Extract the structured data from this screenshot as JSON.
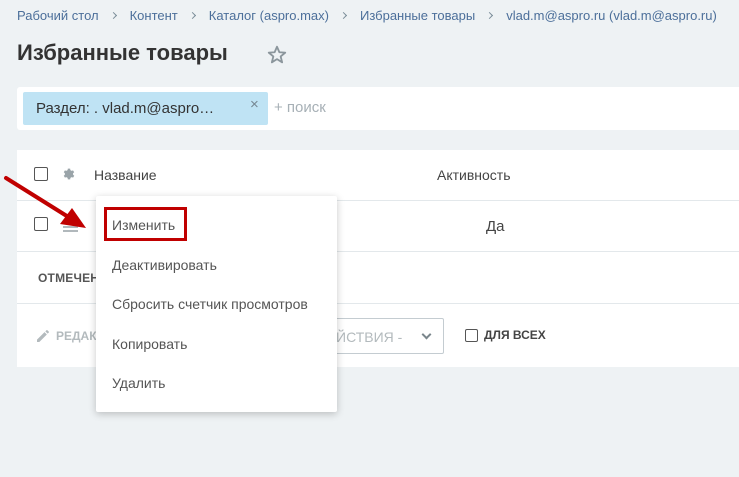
{
  "breadcrumb": [
    "Рабочий стол",
    "Контент",
    "Каталог (aspro.max)",
    "Избранные товары",
    "vlad.m@aspro.ru (vlad.m@aspro.ru)"
  ],
  "page_title": "Избранные товары",
  "filter": {
    "chip_label": "Раздел: . vlad.m@aspro…",
    "chip_close": "×",
    "search_placeholder": "+ поиск"
  },
  "grid": {
    "columns": {
      "name": "Название",
      "active": "Активность"
    },
    "rows": [
      {
        "active": "Да"
      }
    ],
    "marked_label": "ОТМЕЧЕН",
    "edit_label": "РЕДАК",
    "actions_select": "ЙСТВИЯ -",
    "for_all_label": "ДЛЯ ВСЕХ"
  },
  "context_menu": {
    "items": [
      "Изменить",
      "Деактивировать",
      "Сбросить счетчик просмотров",
      "Копировать",
      "Удалить"
    ]
  },
  "colors": {
    "background": "#eef2f4",
    "chip": "#bfe3f4",
    "highlight": "#c00000",
    "link": "#4c6f9a"
  },
  "icons": [
    "star-icon",
    "gear-icon",
    "menu-icon",
    "pencil-icon",
    "chevron-down-icon",
    "arrow-icon"
  ]
}
